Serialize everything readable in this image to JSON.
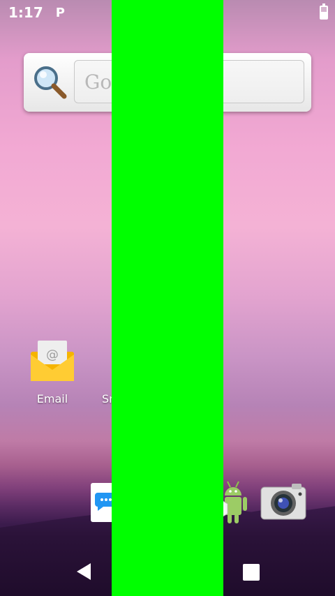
{
  "status_bar": {
    "time": "1:17",
    "notification_letter": "P"
  },
  "search_widget": {
    "placeholder_partial": "Go"
  },
  "apps": [
    {
      "label": "Email",
      "icon": "email-envelope-icon"
    },
    {
      "label": "Sn",
      "icon": "partially-hidden-app-icon"
    }
  ],
  "dock": [
    {
      "icon": "messaging-icon"
    },
    {
      "icon": "android-apps-icon"
    },
    {
      "icon": "camera-icon"
    }
  ],
  "nav": {
    "back_icon": "back-triangle-icon",
    "recents_icon": "recents-square-icon"
  },
  "colors": {
    "occluding_bar": "#00ff00"
  }
}
